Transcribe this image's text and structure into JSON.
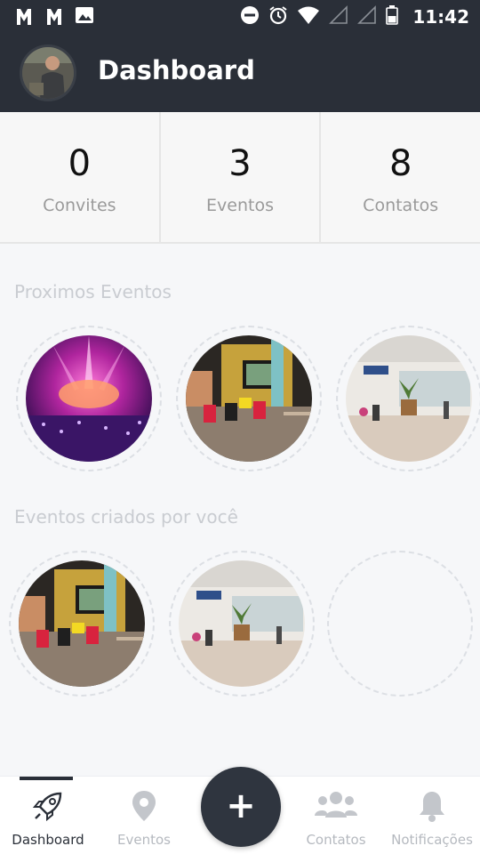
{
  "status_bar": {
    "time": "11:42"
  },
  "header": {
    "title": "Dashboard"
  },
  "stats": [
    {
      "value": "0",
      "label": "Convites"
    },
    {
      "value": "3",
      "label": "Eventos"
    },
    {
      "value": "8",
      "label": "Contatos"
    }
  ],
  "sections": {
    "upcoming_title": "Proximos Eventos",
    "created_title": "Eventos criados por você"
  },
  "nav": {
    "dashboard": "Dashboard",
    "eventos": "Eventos",
    "contatos": "Contatos",
    "notificacoes": "Notificações",
    "fab": "+"
  },
  "icons": [
    "rocket-icon",
    "map-pin-icon",
    "users-icon",
    "bell-icon",
    "plus-icon"
  ],
  "colors": {
    "header_bg": "#2a2f38",
    "inactive": "#b5b9bf",
    "active": "#2a2f38"
  }
}
